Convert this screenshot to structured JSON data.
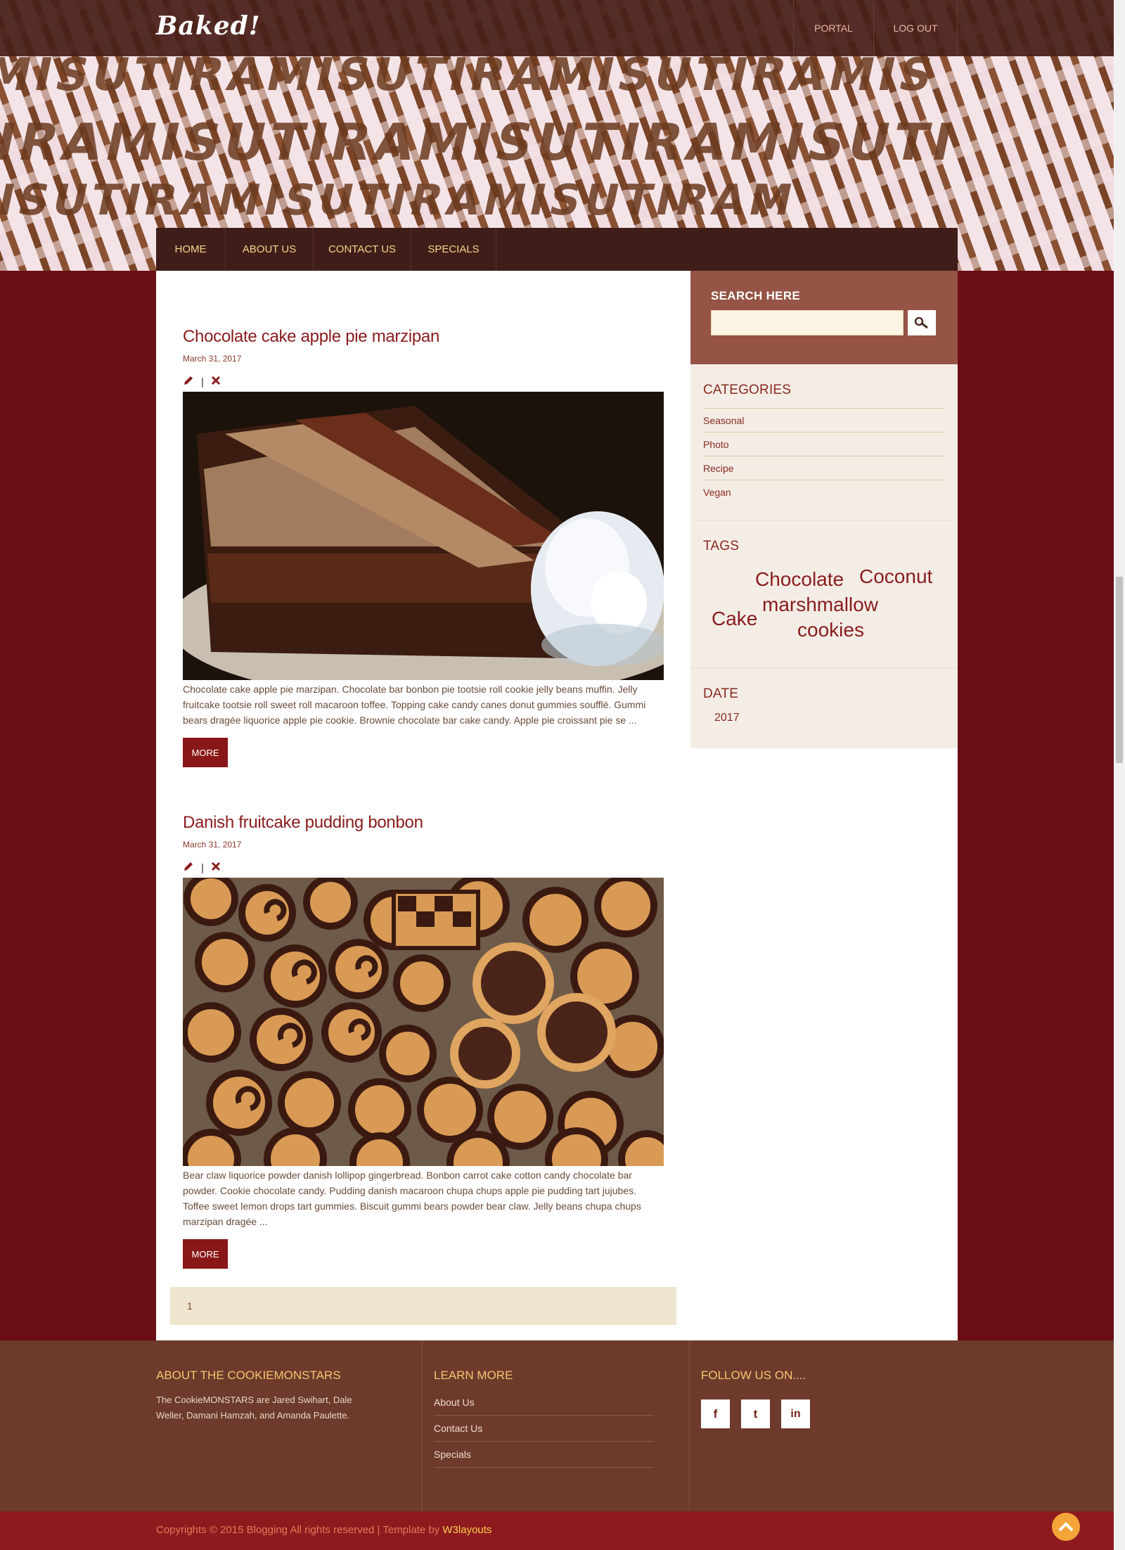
{
  "header": {
    "logo": "Baked!",
    "top_links": [
      "PORTAL",
      "LOG OUT"
    ],
    "banner_text": [
      "MISUTIRAMISUTIRAMISUTIRAMIS",
      "TIRAMISUTIRAMISUTIRAMISUTI",
      "AMISUTIRAMISUTIRAMISUTIRAM"
    ]
  },
  "nav": [
    "HOME",
    "ABOUT US",
    "CONTACT US",
    "SPECIALS"
  ],
  "posts": [
    {
      "title": "Chocolate cake apple pie marzipan",
      "date": "March 31, 2017",
      "separator": "|",
      "excerpt": "Chocolate cake apple pie marzipan. Chocolate bar bonbon pie tootsie roll cookie jelly beans muffin. Jelly fruitcake tootsie roll sweet roll macaroon toffee. Topping cake candy canes donut gummies soufflé. Gummi bears dragée liquorice apple pie cookie. Brownie chocolate bar cake candy. Apple pie croissant pie se ...",
      "more": "MORE"
    },
    {
      "title": "Danish fruitcake pudding bonbon",
      "date": "March 31, 2017",
      "separator": "|",
      "excerpt": "Bear claw liquorice powder danish lollipop gingerbread. Bonbon carrot cake cotton candy chocolate bar powder. Cookie chocolate candy. Pudding danish macaroon chupa chups apple pie pudding tart jujubes. Toffee sweet lemon drops tart gummies. Biscuit gummi bears powder bear claw. Jelly beans chupa chups marzipan dragée ...",
      "more": "MORE"
    }
  ],
  "pagination": "1",
  "sidebar": {
    "search_title": "SEARCH HERE",
    "search_value": "",
    "categories_title": "CATEGORIES",
    "categories": [
      "Seasonal",
      "Photo",
      "Recipe",
      "Vegan"
    ],
    "tags_title": "TAGS",
    "tags": [
      "Chocolate",
      "Coconut",
      "marshmallow",
      "Cake",
      "cookies"
    ],
    "date_title": "DATE",
    "date_year": "2017"
  },
  "footer": {
    "about_title": "ABOUT THE COOKIEMONSTARS",
    "about_text": "The CookieMONSTARS are Jared Swihart, Dale Weller, Damani Hamzah, and Amanda Paulette.",
    "learn_title": "LEARN MORE",
    "learn_links": [
      "About Us",
      "Contact Us",
      "Specials"
    ],
    "follow_title": "FOLLOW US ON....",
    "social": [
      "f",
      "t",
      "in"
    ],
    "copyright": "Copyrights © 2015 Blogging All rights reserved | Template by ",
    "copyright_link": "W3layouts"
  },
  "colors": {
    "accent": "#8a1717",
    "nav_text": "#f4d58b",
    "footer_bg": "#6d3a2c",
    "page_bg": "#6a0d14"
  }
}
